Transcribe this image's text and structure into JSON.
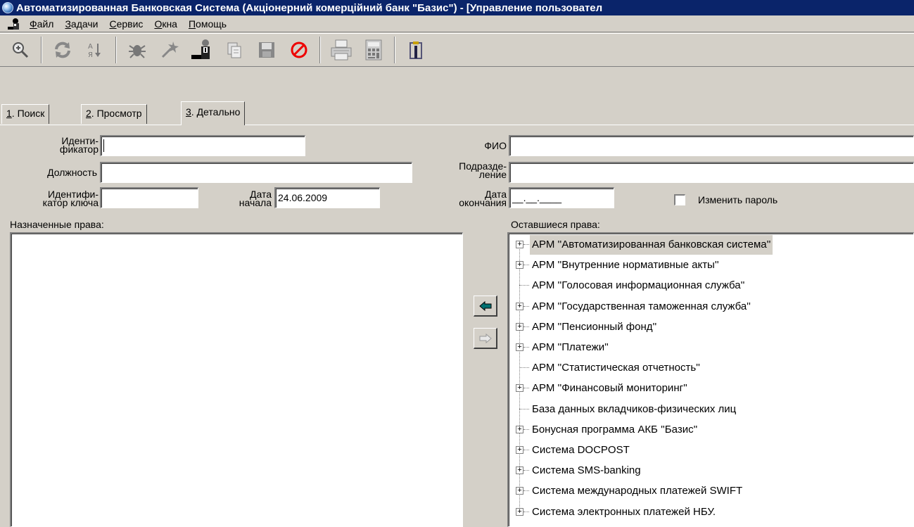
{
  "window": {
    "title": "Автоматизированная Банковская Система (Акціонерний комерційний банк \"Базис\") - [Управление пользовател"
  },
  "menu": {
    "items": [
      {
        "label": "Файл",
        "accel": "Ф",
        "rest": "айл"
      },
      {
        "label": "Задачи",
        "accel": "З",
        "rest": "адачи"
      },
      {
        "label": "Сервис",
        "accel": "С",
        "rest": "ервис"
      },
      {
        "label": "Окна",
        "accel": "О",
        "rest": "кна"
      },
      {
        "label": "Помощь",
        "accel": "П",
        "rest": "омощь"
      }
    ]
  },
  "toolbar": {
    "icons": [
      "zoom-icon",
      "refresh-icon",
      "sort-az-icon",
      "bug-icon",
      "magic-icon",
      "user-agent-icon",
      "copy-doc-icon",
      "save-disk-icon",
      "cancel-icon",
      "printer-icon",
      "calculator-icon",
      "exit-door-icon"
    ]
  },
  "tabs": [
    {
      "accel": "1",
      "rest": ". Поиск"
    },
    {
      "accel": "2",
      "rest": ". Просмотр"
    },
    {
      "accel": "3",
      "rest": ". Детально"
    }
  ],
  "form": {
    "identifier_label_1": "Иденти-",
    "identifier_label_2": "фикатор",
    "identifier_value": "",
    "position_label": "Должность",
    "position_value": "",
    "key_id_label_1": "Идентифи-",
    "key_id_label_2": "катор ключа",
    "key_id_value": "",
    "start_date_label_1": "Дата",
    "start_date_label_2": "начала",
    "start_date_value": "24.06.2009",
    "fio_label": "ФИО",
    "fio_value": "",
    "department_label_1": "Подразде-",
    "department_label_2": "ление",
    "department_value": "",
    "end_date_label_1": "Дата",
    "end_date_label_2": "окончания",
    "end_date_value": "__.__.____",
    "change_password_label": "Изменить пароль",
    "change_password_checked": false
  },
  "assigned_rights": {
    "label": "Назначенные права:",
    "items": []
  },
  "remaining_rights": {
    "label": "Оставшиеся права:",
    "items": [
      {
        "label": "АРМ ''Автоматизированная банковская система''",
        "expandable": true,
        "selected": true
      },
      {
        "label": "АРМ ''Внутренние нормативные акты''",
        "expandable": true,
        "selected": false
      },
      {
        "label": "АРМ ''Голосовая информационная служба''",
        "expandable": false,
        "selected": false
      },
      {
        "label": "АРМ ''Государственная таможенная служба''",
        "expandable": true,
        "selected": false
      },
      {
        "label": "АРМ ''Пенсионный фонд''",
        "expandable": true,
        "selected": false
      },
      {
        "label": "АРМ ''Платежи''",
        "expandable": true,
        "selected": false
      },
      {
        "label": "АРМ ''Статистическая отчетность''",
        "expandable": false,
        "selected": false
      },
      {
        "label": "АРМ ''Финансовый мониторинг''",
        "expandable": true,
        "selected": false
      },
      {
        "label": "База данных вкладчиков-физических лиц",
        "expandable": false,
        "selected": false
      },
      {
        "label": "Бонусная программа АКБ ''Базис''",
        "expandable": true,
        "selected": false
      },
      {
        "label": "Система DOCPOST",
        "expandable": true,
        "selected": false
      },
      {
        "label": "Система SMS-banking",
        "expandable": true,
        "selected": false
      },
      {
        "label": "Система международных платежей SWIFT",
        "expandable": true,
        "selected": false
      },
      {
        "label": "Система электронных платежей НБУ.",
        "expandable": true,
        "selected": false
      }
    ]
  },
  "transfer": {
    "add_icon": "arrow-left-icon",
    "remove_icon": "arrow-right-icon"
  },
  "colors": {
    "titlebar": "#0a246a",
    "window_face": "#d4d0c8",
    "arrow_active": "#007070"
  }
}
